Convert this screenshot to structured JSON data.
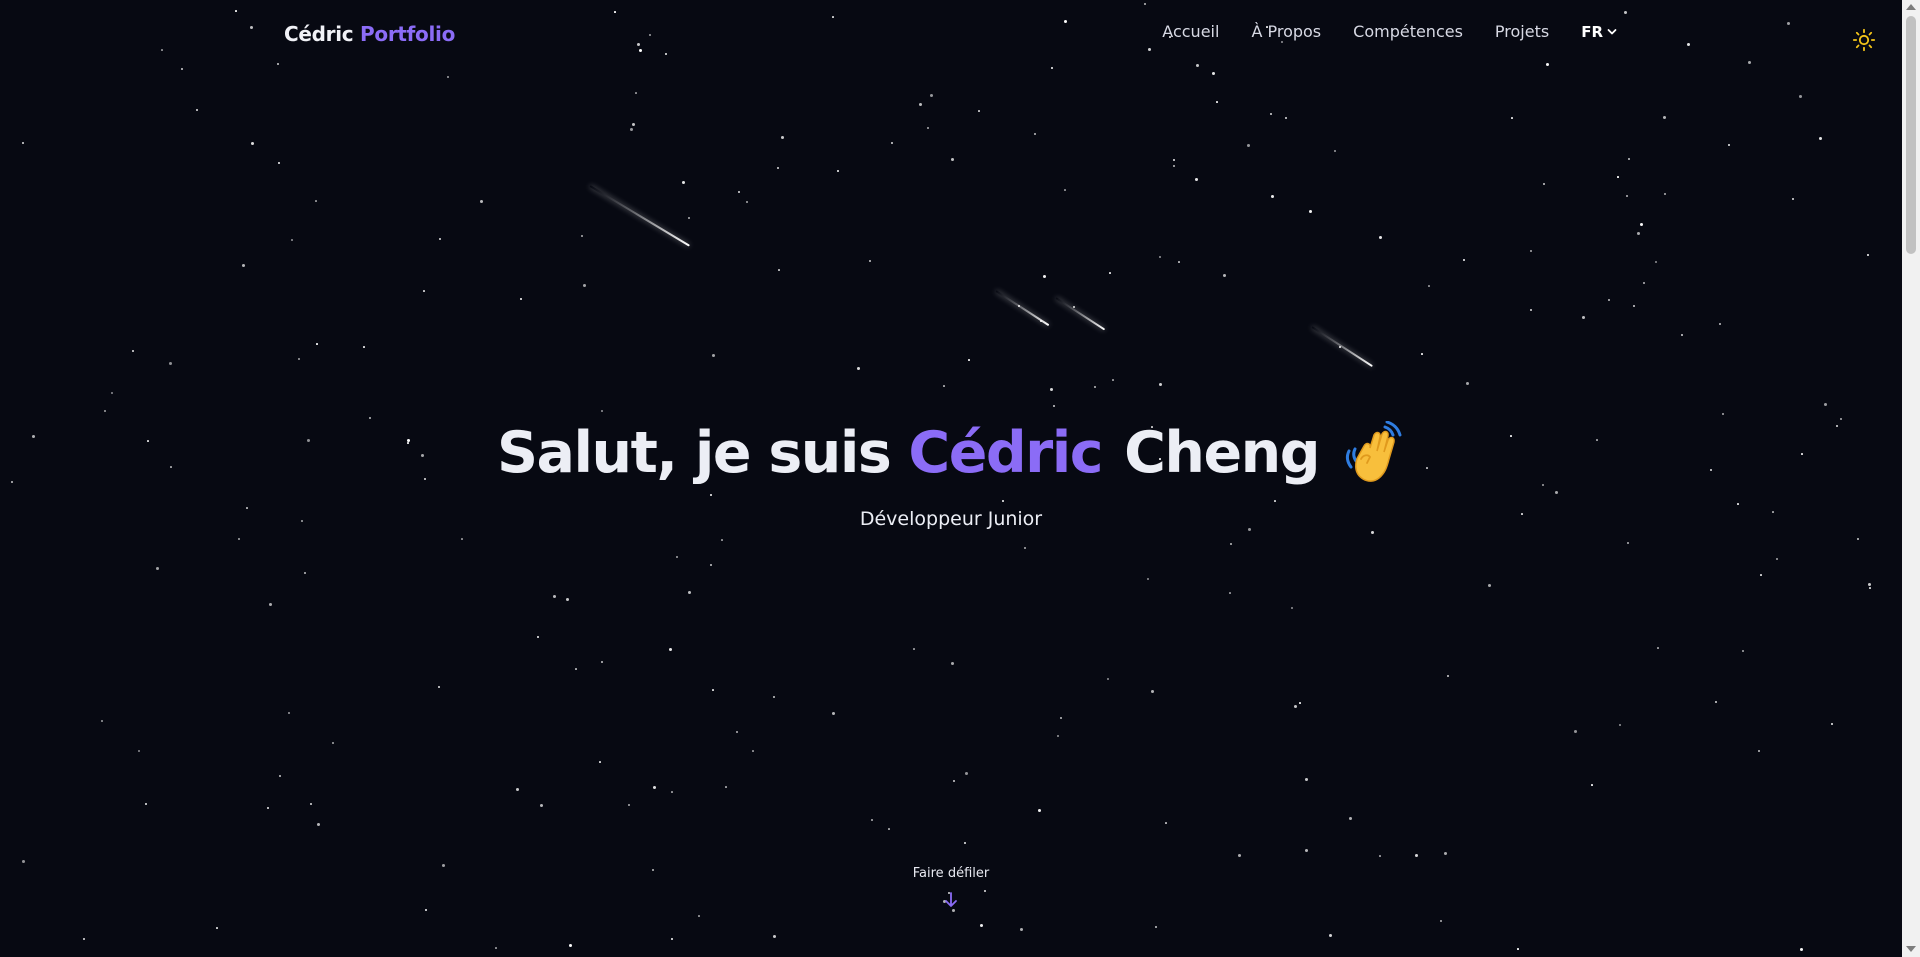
{
  "nav": {
    "brand_name": "Cédric",
    "brand_accent": "Portfolio",
    "links": [
      {
        "label": "Accueil"
      },
      {
        "label": "À Propos"
      },
      {
        "label": "Compétences"
      },
      {
        "label": "Projets"
      }
    ],
    "language": "FR",
    "theme_icon": "sun-icon"
  },
  "hero": {
    "greeting": "Salut, je suis",
    "first_name": "Cédric",
    "last_name": "Cheng",
    "emoji": "👋",
    "subtitle": "Développeur Junior"
  },
  "scroll_hint": {
    "label": "Faire défiler",
    "icon": "arrow-down-icon"
  },
  "colors": {
    "background": "#070912",
    "accent": "#8b6cf6",
    "text": "#eceef5",
    "sun": "#f5c518"
  }
}
